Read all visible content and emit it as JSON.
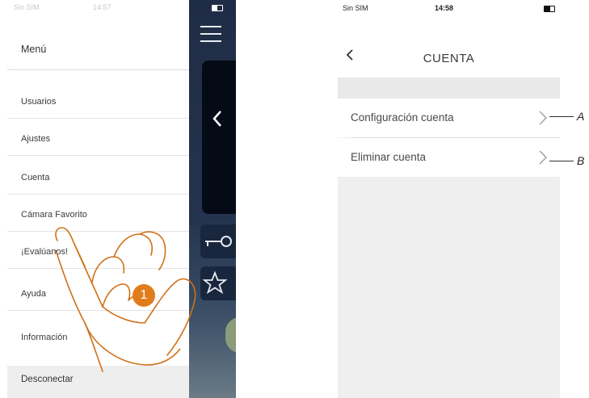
{
  "left_screen": {
    "status": {
      "carrier": "Sin SIM",
      "time": "14:57"
    },
    "menu_title": "Menú",
    "menu_items": [
      {
        "label": "Usuarios"
      },
      {
        "label": "Ajustes"
      },
      {
        "label": "Cuenta"
      },
      {
        "label": "Cámara Favorito"
      },
      {
        "label": "¡Evalúanos!"
      },
      {
        "label": "Ayuda"
      },
      {
        "label": "Información"
      }
    ],
    "disconnect_label": "Desconectar",
    "step_badge": "1"
  },
  "right_screen": {
    "status": {
      "carrier": "Sin SIM",
      "time": "14:58"
    },
    "title": "CUENTA",
    "rows": [
      {
        "label": "Configuración cuenta",
        "callout": "A"
      },
      {
        "label": "Eliminar cuenta",
        "callout": "B"
      }
    ]
  },
  "colors": {
    "accent": "#e27b1c",
    "dark_bg": "#1f2c45"
  }
}
